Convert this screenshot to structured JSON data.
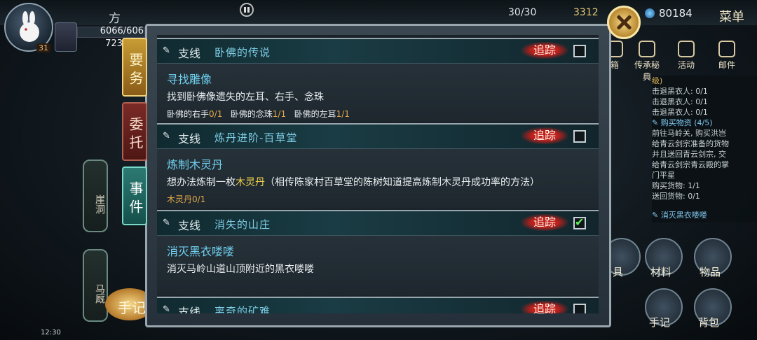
{
  "hud": {
    "title_partial": "方",
    "hp": "6066/606",
    "mp": "723",
    "level": "31",
    "stamina": "30/30",
    "coins": "3312",
    "gems": "80184",
    "menu_label": "菜单"
  },
  "tabs": {
    "main": "要务",
    "commission": "委托",
    "event": "事件"
  },
  "right_icons": [
    "箱",
    "传承秘典",
    "活动",
    "邮件"
  ],
  "side_quests": {
    "lines": [
      {
        "text": "级)",
        "cls": "qs-hl"
      },
      {
        "text": "击退黑衣人: 0/1"
      },
      {
        "text": "击退黑衣人: 0/1"
      },
      {
        "text": "击退黑衣人: 0/1"
      },
      {
        "text": "✎ 购买物资 (4/5)",
        "cls": "qs-title"
      },
      {
        "text": "前往马岭关, 购买洪岂"
      },
      {
        "text": "给青云剑宗准备的货物"
      },
      {
        "text": "并且送回青云剑宗, 交"
      },
      {
        "text": "给青云剑宗青云殿的掌"
      },
      {
        "text": "门平星"
      },
      {
        "text": "购买货物: 1/1"
      },
      {
        "text": "送回货物: 0/1"
      },
      {
        "text": "✎ 消灭黑衣喽喽",
        "cls": "qs-title"
      }
    ]
  },
  "bottom_right": {
    "materials": "材料",
    "items": "物品",
    "journal": "手记",
    "bag": "背包",
    "partial": "具"
  },
  "map_nodes": [
    "崖洞",
    "马厩"
  ],
  "journal_button": "手记",
  "status_time": "12:30",
  "quests": [
    {
      "kind": "支线",
      "name": "卧佛的传说",
      "track": "追踪",
      "checked": false,
      "sub": "寻找雕像",
      "desc": "找到卧佛像遗失的左耳、右手、念珠",
      "progress": [
        {
          "label": "卧佛的右手",
          "count": "0/1"
        },
        {
          "label": "卧佛的念珠",
          "count": "1/1"
        },
        {
          "label": "卧佛的左耳",
          "count": "1/1"
        }
      ]
    },
    {
      "kind": "支线",
      "name": "炼丹进阶-百草堂",
      "track": "追踪",
      "checked": false,
      "sub": "炼制木灵丹",
      "desc_pre": "想办法炼制一枚",
      "desc_hl": "木灵丹",
      "desc_post": "（相传陈家村百草堂的陈树知道提高炼制木灵丹成功率的方法）",
      "gold_progress": "木灵丹0/1"
    },
    {
      "kind": "支线",
      "name": "消失的山庄",
      "track": "追踪",
      "checked": true,
      "sub": "消灭黑衣喽喽",
      "desc": "消灭马岭山道山顶附近的黑衣喽喽"
    },
    {
      "kind": "支线",
      "name": "离奇的矿难",
      "track": "追踪",
      "checked": false
    }
  ]
}
